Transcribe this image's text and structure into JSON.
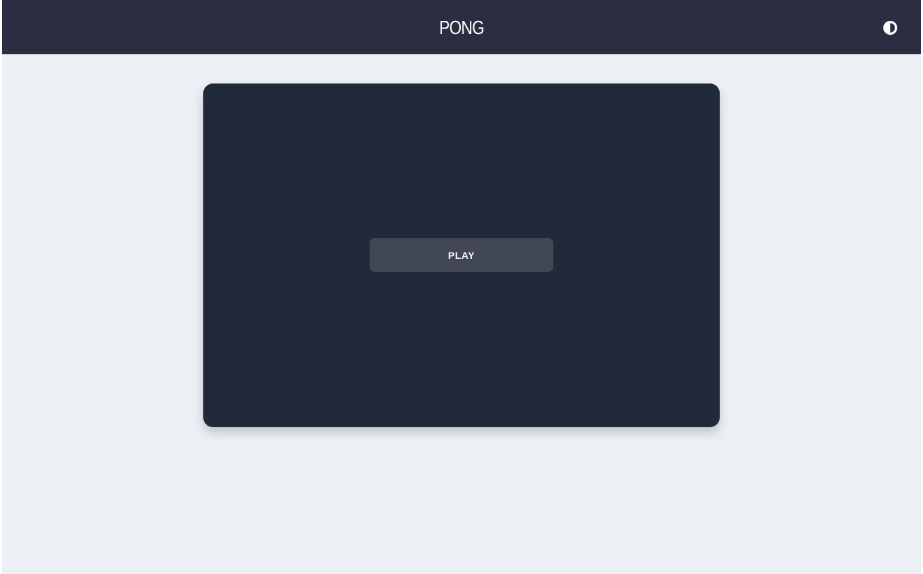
{
  "header": {
    "title": "PONG",
    "theme_toggle_icon": "contrast-icon"
  },
  "game": {
    "play_label": "PLAY"
  },
  "colors": {
    "header_background": "#2c2c43",
    "page_background": "#ecf0f4",
    "board_background": "#212a38",
    "button_background": "#424754",
    "text": "#ffffff"
  }
}
